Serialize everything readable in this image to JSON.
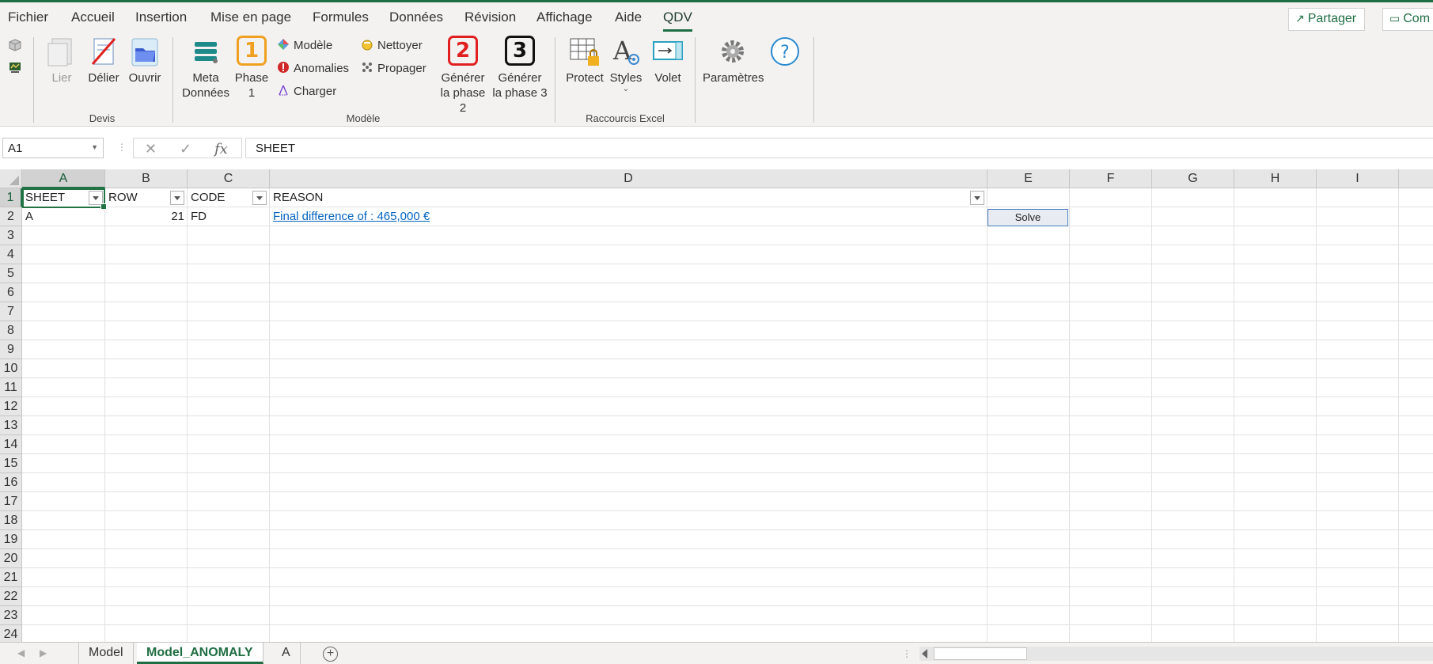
{
  "ribbon_tabs": [
    "Fichier",
    "Accueil",
    "Insertion",
    "Mise en page",
    "Formules",
    "Données",
    "Révision",
    "Affichage",
    "Aide",
    "QDV"
  ],
  "active_tab": "QDV",
  "top_buttons": {
    "share": "Partager",
    "comments": "Com"
  },
  "groups": {
    "devis": {
      "label": "Devis",
      "lier": "Lier",
      "delier": "Délier",
      "ouvrir": "Ouvrir"
    },
    "modele": {
      "label": "Modèle",
      "meta_line1": "Meta",
      "meta_line2": "Données",
      "phase_line1": "Phase",
      "phase_line2": "1",
      "phase_num": "1",
      "modele": "Modèle",
      "anomalies": "Anomalies",
      "charger": "Charger",
      "nettoyer": "Nettoyer",
      "propager": "Propager",
      "gen2_line1": "Générer",
      "gen2_line2": "la phase 2",
      "gen2_num": "2",
      "gen3_line1": "Générer",
      "gen3_line2": "la phase 3",
      "gen3_num": "3"
    },
    "raccourcis": {
      "label": "Raccourcis Excel",
      "protect": "Protect",
      "styles": "Styles",
      "volet": "Volet"
    },
    "parametres": {
      "label": "Paramètres"
    }
  },
  "formula_bar": {
    "name_box": "A1",
    "fx": "fx",
    "formula": "SHEET"
  },
  "grid": {
    "columns": [
      "A",
      "B",
      "C",
      "D",
      "E",
      "F",
      "G",
      "H",
      "I"
    ],
    "rows": [
      "1",
      "2",
      "3",
      "4",
      "5",
      "6",
      "7",
      "8",
      "9",
      "10",
      "11",
      "12",
      "13",
      "14",
      "15",
      "16",
      "17",
      "18",
      "19",
      "20",
      "21",
      "22",
      "23",
      "24"
    ],
    "header_row": {
      "a": "SHEET",
      "b": "ROW",
      "c": "CODE",
      "d": "REASON"
    },
    "data_row": {
      "a": "A",
      "b": "21",
      "c": "FD",
      "d": "Final difference of : 465,000 €"
    },
    "solve_button": "Solve"
  },
  "sheet_tabs": [
    "Model",
    "Model_ANOMALY",
    "A"
  ],
  "active_sheet": "Model_ANOMALY",
  "colors": {
    "accent": "#1f6e43",
    "link": "#0563c1",
    "phase1": "#f0a020",
    "phase2": "#e02020",
    "phase3": "#111111"
  }
}
